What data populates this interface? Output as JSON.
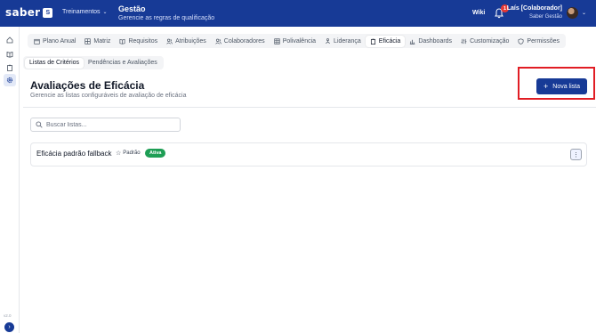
{
  "header": {
    "brand": "saber",
    "brand_box": "S",
    "module": "Treinamentos",
    "title": "Gestão",
    "subtitle": "Gerencie as regras de qualificação",
    "wiki": "Wiki",
    "notifications": "1",
    "user_name": "Laís [Colaborador]",
    "user_org": "Saber Gestão"
  },
  "sidebar": {
    "items": [
      {
        "icon": "home-icon"
      },
      {
        "icon": "book-icon"
      },
      {
        "icon": "clipboard-icon"
      },
      {
        "icon": "gear-icon"
      }
    ],
    "version": "v2.0",
    "expand": "›"
  },
  "tabs": [
    {
      "label": "Plano Anual",
      "icon": "calendar-icon"
    },
    {
      "label": "Matriz",
      "icon": "grid-icon"
    },
    {
      "label": "Requisitos",
      "icon": "book-icon"
    },
    {
      "label": "Atribuições",
      "icon": "users-icon"
    },
    {
      "label": "Colaboradores",
      "icon": "users-icon"
    },
    {
      "label": "Polivalência",
      "icon": "matrix-icon"
    },
    {
      "label": "Liderança",
      "icon": "hierarchy-icon"
    },
    {
      "label": "Eficácia",
      "icon": "clipboard-icon",
      "active": true
    },
    {
      "label": "Dashboards",
      "icon": "bar-chart-icon"
    },
    {
      "label": "Customização",
      "icon": "sliders-icon"
    },
    {
      "label": "Permissões",
      "icon": "shield-icon"
    }
  ],
  "subtabs": [
    {
      "label": "Listas de Critérios",
      "active": true
    },
    {
      "label": "Pendências e Avaliações"
    }
  ],
  "page": {
    "title": "Avaliações de Eficácia",
    "subtitle": "Gerencie as listas configuráveis de avaliação de eficácia",
    "new_button": "Nova lista"
  },
  "search": {
    "placeholder": "Buscar listas..."
  },
  "lists": [
    {
      "name": "Eficácia padrão fallback",
      "default_label": "Padrão",
      "status": "Ativa",
      "menu": "⋮"
    }
  ],
  "colors": {
    "primary": "#173a96",
    "success": "#1e9e55",
    "highlight": "#e11d24",
    "badge": "#e53935"
  }
}
